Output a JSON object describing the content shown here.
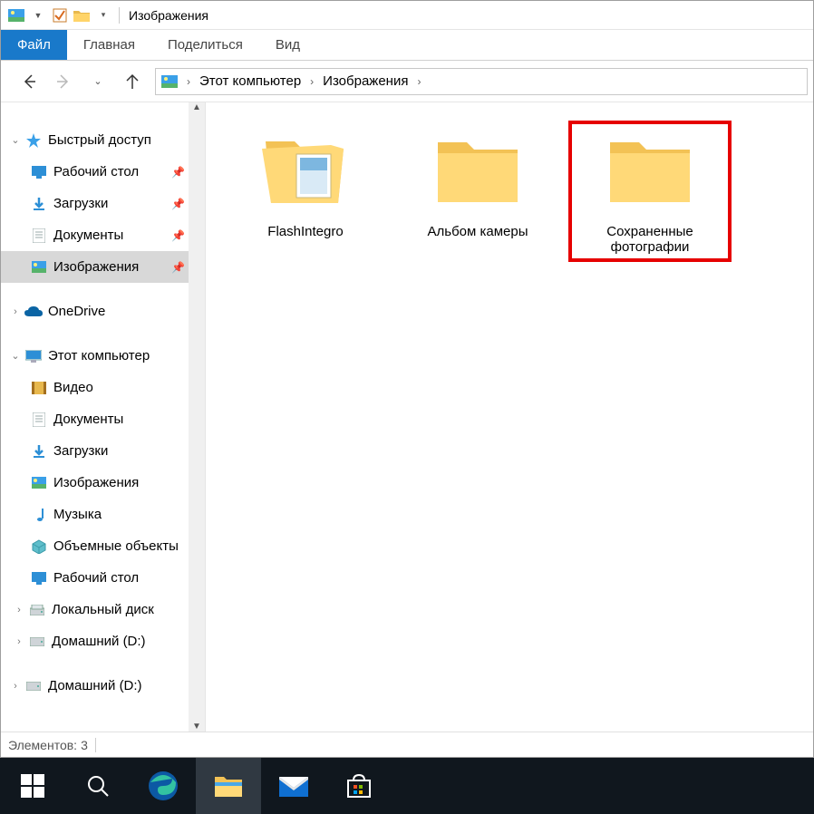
{
  "window": {
    "title": "Изображения"
  },
  "ribbon": {
    "file": "Файл",
    "home": "Главная",
    "share": "Поделиться",
    "view": "Вид"
  },
  "breadcrumb": {
    "seg1": "Этот компьютер",
    "seg2": "Изображения"
  },
  "nav": {
    "quick_access": "Быстрый доступ",
    "desktop": "Рабочий стол",
    "downloads": "Загрузки",
    "documents": "Документы",
    "pictures": "Изображения",
    "onedrive": "OneDrive",
    "this_pc": "Этот компьютер",
    "videos": "Видео",
    "documents2": "Документы",
    "downloads2": "Загрузки",
    "pictures2": "Изображения",
    "music": "Музыка",
    "objects3d": "Объемные объекты",
    "desktop2": "Рабочий стол",
    "localdisk": "Локальный диск",
    "home_d": "Домашний (D:)",
    "home_d2": "Домашний (D:)"
  },
  "items": [
    {
      "name": "FlashIntegro",
      "kind": "folder-docs"
    },
    {
      "name": "Альбом камеры",
      "kind": "folder"
    },
    {
      "name": "Сохраненные фотографии",
      "kind": "folder"
    }
  ],
  "status": {
    "count_label": "Элементов:",
    "count_value": "3"
  }
}
